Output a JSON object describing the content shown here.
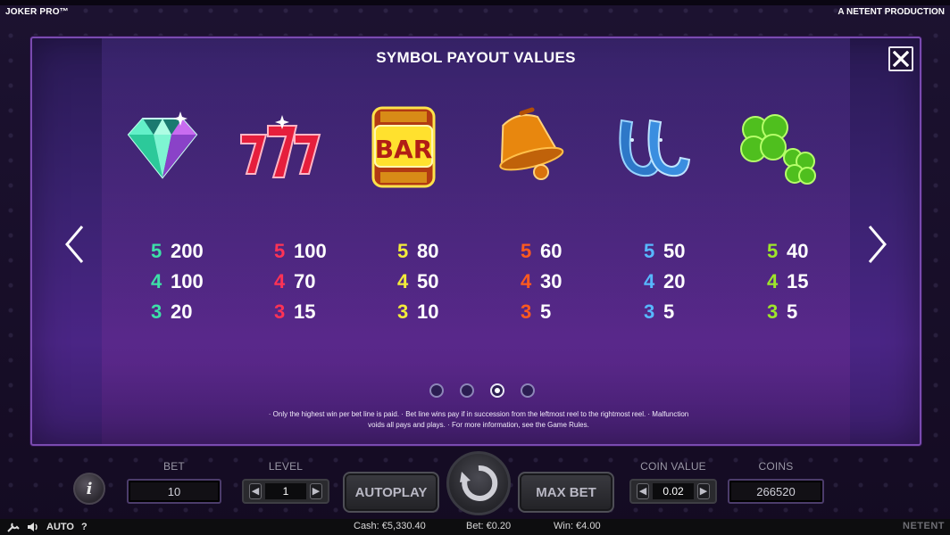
{
  "header": {
    "game_title": "JOKER PRO™",
    "producer": "A NETENT PRODUCTION"
  },
  "paytable": {
    "title": "SYMBOL PAYOUT VALUES",
    "symbols": [
      {
        "icon": "diamond-icon",
        "color": "#3de0a8",
        "pays": [
          {
            "count": "5",
            "value": "200"
          },
          {
            "count": "4",
            "value": "100"
          },
          {
            "count": "3",
            "value": "20"
          }
        ]
      },
      {
        "icon": "triple-seven-icon",
        "color": "#ff3355",
        "pays": [
          {
            "count": "5",
            "value": "100"
          },
          {
            "count": "4",
            "value": "70"
          },
          {
            "count": "3",
            "value": "15"
          }
        ]
      },
      {
        "icon": "bar-icon",
        "color": "#f3ec3a",
        "pays": [
          {
            "count": "5",
            "value": "80"
          },
          {
            "count": "4",
            "value": "50"
          },
          {
            "count": "3",
            "value": "10"
          }
        ]
      },
      {
        "icon": "bell-icon",
        "color": "#ff5a1e",
        "pays": [
          {
            "count": "5",
            "value": "60"
          },
          {
            "count": "4",
            "value": "30"
          },
          {
            "count": "3",
            "value": "5"
          }
        ]
      },
      {
        "icon": "horseshoe-icon",
        "color": "#57b8ff",
        "pays": [
          {
            "count": "5",
            "value": "50"
          },
          {
            "count": "4",
            "value": "20"
          },
          {
            "count": "3",
            "value": "5"
          }
        ]
      },
      {
        "icon": "clover-icon",
        "color": "#9ee62a",
        "pays": [
          {
            "count": "5",
            "value": "40"
          },
          {
            "count": "4",
            "value": "15"
          },
          {
            "count": "3",
            "value": "5"
          }
        ]
      }
    ],
    "page_count": 4,
    "active_page": 3,
    "footnote_line1": "·  Only the highest win per bet line is paid.  ·  Bet line wins pay if in succession from the leftmost reel to the rightmost reel.  ·  Malfunction",
    "footnote_line2": "voids all pays and plays.  ·  For more information, see the Game Rules."
  },
  "controls": {
    "bet_label": "BET",
    "bet_value": "10",
    "level_label": "LEVEL",
    "level_value": "1",
    "autoplay_label": "AUTOPLAY",
    "max_bet_label": "MAX BET",
    "coin_value_label": "COIN VALUE",
    "coin_value": "0.02",
    "coins_label": "COINS",
    "coins_value": "266520",
    "info_label": "i"
  },
  "status_bar": {
    "auto_label": "AUTO",
    "help_label": "?",
    "cash": "Cash: €5,330.40",
    "bet": "Bet: €0.20",
    "win": "Win: €4.00",
    "brand": "NETENT"
  }
}
